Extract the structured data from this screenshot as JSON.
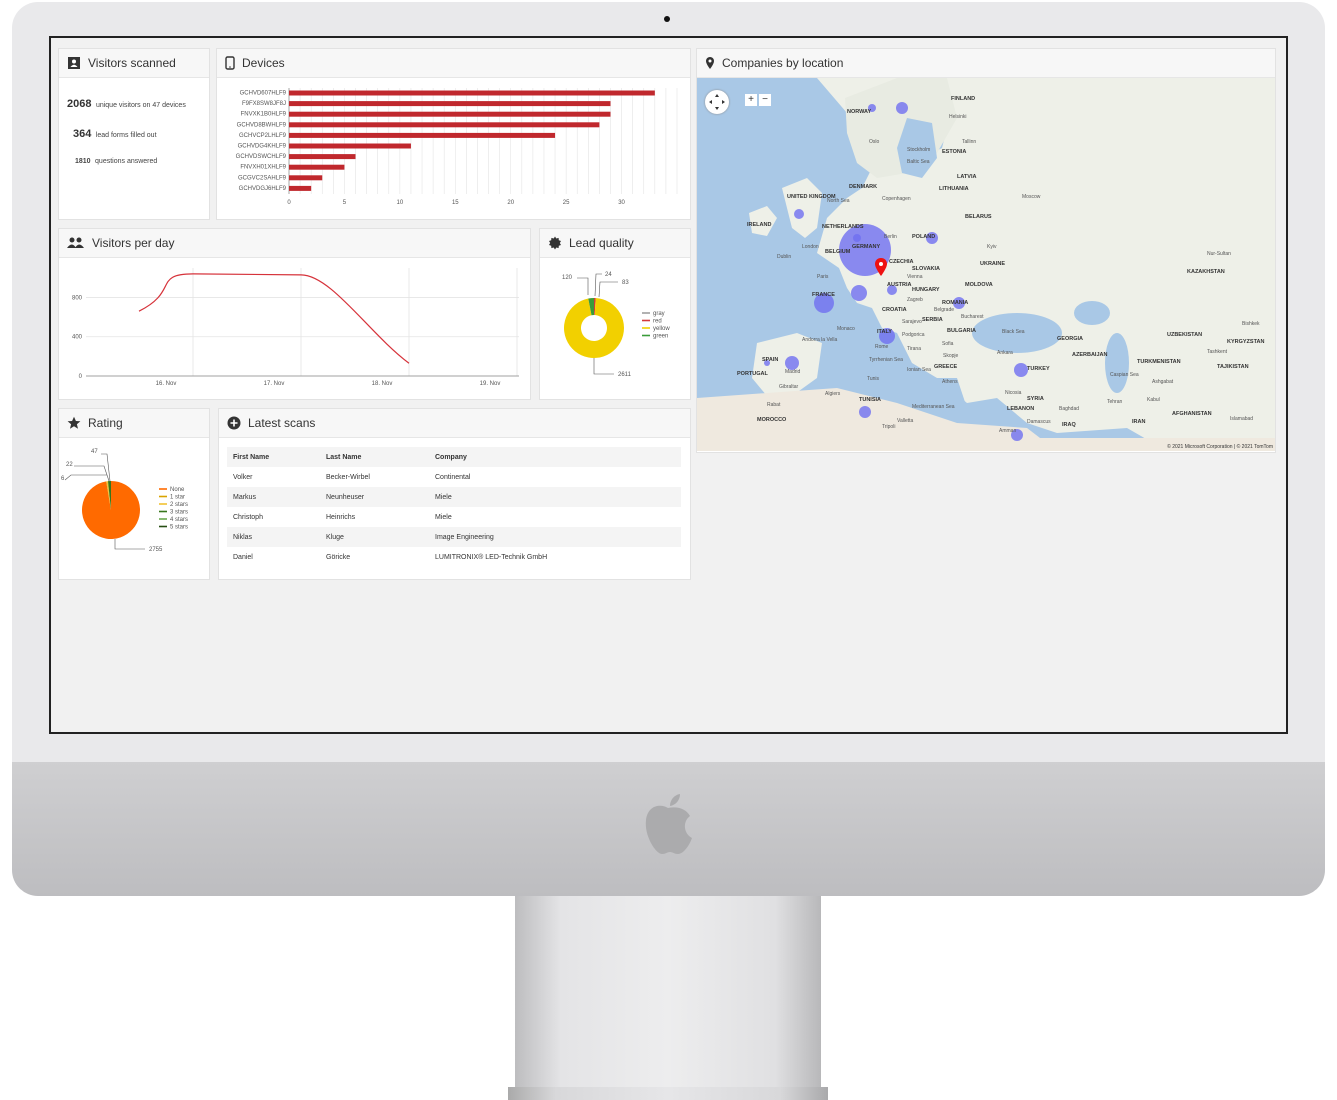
{
  "panels": {
    "visitors_scanned": {
      "title": "Visitors scanned",
      "unique_visitors": "2068",
      "unique_visitors_text": "unique visitors on 47 devices",
      "lead_forms": "364",
      "lead_forms_text": "lead forms filled out",
      "questions": "1810",
      "questions_text": "questions answered"
    },
    "devices": {
      "title": "Devices"
    },
    "visitors_per_day": {
      "title": "Visitors per day"
    },
    "lead_quality": {
      "title": "Lead quality"
    },
    "rating": {
      "title": "Rating"
    },
    "latest_scans": {
      "title": "Latest scans",
      "columns": [
        "First Name",
        "Last Name",
        "Company"
      ],
      "rows": [
        [
          "Volker",
          "Becker-Wirbel",
          "Continental"
        ],
        [
          "Markus",
          "Neunheuser",
          "Miele"
        ],
        [
          "Christoph",
          "Heinrichs",
          "Miele"
        ],
        [
          "Niklas",
          "Kluge",
          "Image Engineering"
        ],
        [
          "Daniel",
          "Göricke",
          "LUMITRONIX® LED-Technik GmbH"
        ]
      ]
    },
    "companies_by_location": {
      "title": "Companies by location",
      "zoom_in": "+",
      "zoom_out": "−",
      "copyright": "© 2021 Microsoft Corporation | © 2021 TomTom",
      "labels": [
        "FINLAND",
        "NORWAY",
        "Oslo",
        "Stockholm",
        "ESTONIA",
        "Helsinki",
        "Tallinn",
        "LATVIA",
        "LITHUANIA",
        "DENMARK",
        "Copenhagen",
        "Baltic Sea",
        "North Sea",
        "UNITED KINGDOM",
        "IRELAND",
        "London",
        "Dublin",
        "NETHERLANDS",
        "BELGIUM",
        "GERMANY",
        "Berlin",
        "POLAND",
        "BELARUS",
        "Moscow",
        "Kyiv",
        "UKRAINE",
        "KAZAKHSTAN",
        "Nur-Sultan",
        "CZECHIA",
        "SLOVAKIA",
        "AUSTRIA",
        "HUNGARY",
        "Vienna",
        "Paris",
        "FRANCE",
        "MOLDOVA",
        "ROMANIA",
        "Bucharest",
        "Belgrade",
        "CROATIA",
        "SERBIA",
        "Zagreb",
        "Sarajevo",
        "BULGARIA",
        "Sofia",
        "Black Sea",
        "GEORGIA",
        "AZERBAIJAN",
        "Caspian Sea",
        "UZBEKISTAN",
        "KYRGYZSTAN",
        "Bishkek",
        "TURKMENISTAN",
        "TAJIKISTAN",
        "Tashkent",
        "Ashgabat",
        "ITALY",
        "Rome",
        "Monaco",
        "Podgorica",
        "Tirana",
        "Andorra la Vella",
        "SPAIN",
        "PORTUGAL",
        "Madrid",
        "Tyrrhenian Sea",
        "Ionian Sea",
        "GREECE",
        "Athens",
        "Ankara",
        "TURKEY",
        "Tunis",
        "Algiers",
        "TUNISIA",
        "Mediterranean Sea",
        "Nicosia",
        "SYRIA",
        "LEBANON",
        "Damascus",
        "Baghdad",
        "IRAQ",
        "Tehran",
        "IRAN",
        "Kabul",
        "AFGHANISTAN",
        "Islamabad",
        "Rabat",
        "MOROCCO",
        "Tripoli",
        "Amman",
        "Gibraltar",
        "Skopje",
        "Valletta"
      ]
    }
  },
  "chart_data": [
    {
      "id": "devices",
      "type": "bar",
      "orientation": "horizontal",
      "categories": [
        "GCHVD607HLF9",
        "F9FX8SW8JF8J",
        "FNVXK1B0HLF9",
        "GCHVD8BWHLF9",
        "GCHVCP2LHLF9",
        "GCHVDG4KHLF9",
        "GCHVDSWCHLF9",
        "FNVXH01XHLF9",
        "GCGVC2SAHLF9",
        "GCHVDGJ6HLF9"
      ],
      "values": [
        33,
        29,
        29,
        28,
        24,
        11,
        6,
        5,
        3,
        2
      ],
      "xlim": [
        0,
        35
      ],
      "xticks": [
        0,
        5,
        10,
        15,
        20,
        25,
        30
      ],
      "color": "#c0282d",
      "grid": "vertical"
    },
    {
      "id": "visitors_per_day",
      "type": "line",
      "x": [
        "16. Nov",
        "17. Nov",
        "18. Nov",
        "19. Nov"
      ],
      "x_positions": [
        0.5,
        1,
        2,
        3
      ],
      "y": [
        660,
        1040,
        1030,
        130
      ],
      "ylim": [
        0,
        1100
      ],
      "yticks": [
        0,
        400,
        800
      ],
      "color": "#d6323a",
      "grid": "both"
    },
    {
      "id": "lead_quality",
      "type": "pie",
      "donut": true,
      "labels": [
        "gray",
        "red",
        "yellow",
        "green"
      ],
      "values": [
        0,
        24,
        2611,
        83
      ],
      "outside_labels": [
        "120",
        "24",
        "83",
        "2611"
      ],
      "colors": [
        "#9e9e9e",
        "#d43a3a",
        "#f2d000",
        "#3a9c3a"
      ],
      "legend": "right"
    },
    {
      "id": "rating",
      "type": "pie",
      "labels": [
        "None",
        "1 star",
        "2 stars",
        "3 stars",
        "4 stars",
        "5 stars"
      ],
      "values": [
        2755,
        6,
        22,
        47,
        0,
        0
      ],
      "outside_labels": [
        "47",
        "22",
        "6",
        "2755"
      ],
      "colors": [
        "#ff6a00",
        "#d9a300",
        "#f1c232",
        "#38761d",
        "#6aa84f",
        "#274e13"
      ],
      "legend": "right"
    }
  ],
  "map_bubbles": [
    {
      "near": "GERMANY",
      "size": "large"
    },
    {
      "near": "FRANCE",
      "size": "medium"
    },
    {
      "near": "ITALY",
      "size": "small"
    },
    {
      "near": "SPAIN",
      "size": "small"
    },
    {
      "near": "TURKEY",
      "size": "small"
    },
    {
      "near": "ROMANIA",
      "size": "small"
    },
    {
      "near": "POLAND",
      "size": "small"
    },
    {
      "near": "UNITED KINGDOM",
      "size": "small"
    }
  ]
}
